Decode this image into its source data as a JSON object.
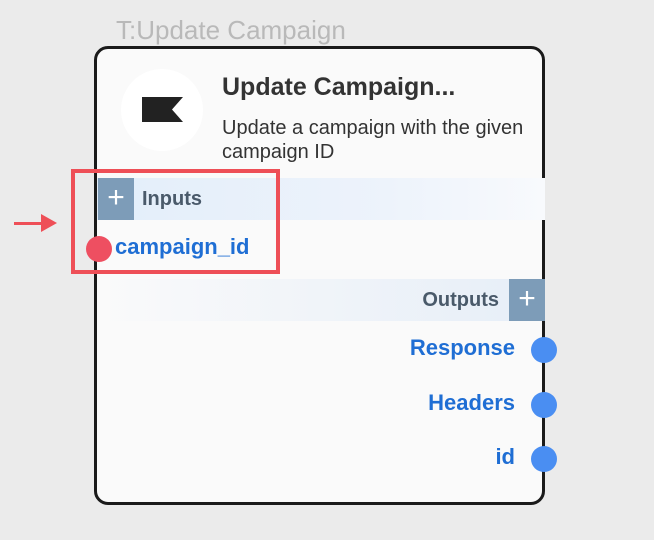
{
  "node": {
    "type_label": "T:Update Campaign",
    "title": "Update Campaign...",
    "description": "Update a campaign with the given campaign ID",
    "logo_icon": "flag-icon"
  },
  "inputs": {
    "label": "Inputs",
    "add_symbol": "+",
    "ports": [
      {
        "label": "campaign_id",
        "dot_color": "#ee4f61"
      }
    ]
  },
  "outputs": {
    "label": "Outputs",
    "add_symbol": "+",
    "ports": [
      {
        "label": "Response",
        "dot_color": "#4a8ef2"
      },
      {
        "label": "Headers",
        "dot_color": "#4a8ef2"
      },
      {
        "label": "id",
        "dot_color": "#4a8ef2"
      }
    ]
  },
  "annotation": {
    "highlight_color": "#ee4f57",
    "arrow_color": "#ee4f57"
  }
}
